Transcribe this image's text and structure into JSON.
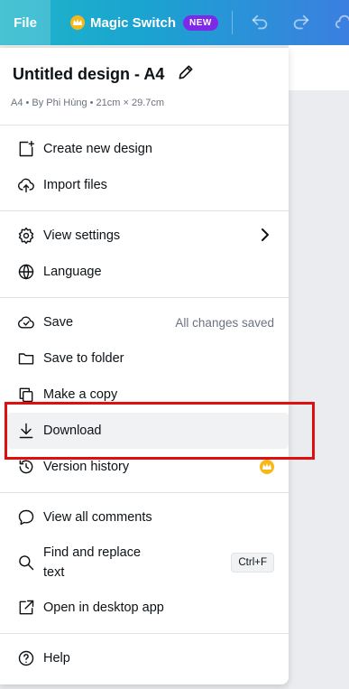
{
  "topbar": {
    "file_label": "File",
    "magic_switch_label": "Magic Switch",
    "new_badge": "NEW",
    "undo_icon": "undo-icon",
    "redo_icon": "redo-icon"
  },
  "menu": {
    "title": "Untitled design - A4",
    "meta": "A4 • By Phi Hùng • 21cm × 29.7cm",
    "items": [
      {
        "label": "Create new design",
        "icon": "create-design-icon"
      },
      {
        "label": "Import files",
        "icon": "upload-cloud-icon"
      },
      {
        "label": "View settings",
        "icon": "gear-icon"
      },
      {
        "label": "Language",
        "icon": "globe-icon"
      },
      {
        "label": "Save",
        "icon": "cloud-check-icon",
        "note": "All changes saved"
      },
      {
        "label": "Save to folder",
        "icon": "folder-icon"
      },
      {
        "label": "Make a copy",
        "icon": "copy-icon"
      },
      {
        "label": "Download",
        "icon": "download-icon"
      },
      {
        "label": "Version history",
        "icon": "history-icon"
      },
      {
        "label": "View all comments",
        "icon": "comment-icon"
      },
      {
        "label": "Find and replace",
        "label2": "text",
        "icon": "search-icon",
        "shortcut": "Ctrl+F"
      },
      {
        "label": "Open in desktop app",
        "icon": "external-link-icon"
      },
      {
        "label": "Help",
        "icon": "help-icon"
      }
    ]
  },
  "colors": {
    "accent_gradient_start": "#1fb6c9",
    "accent_gradient_end": "#3b7fe0",
    "badge_purple": "#7d2ae8",
    "crown_gold": "#f7b719",
    "highlight_red": "#e00f0f"
  }
}
